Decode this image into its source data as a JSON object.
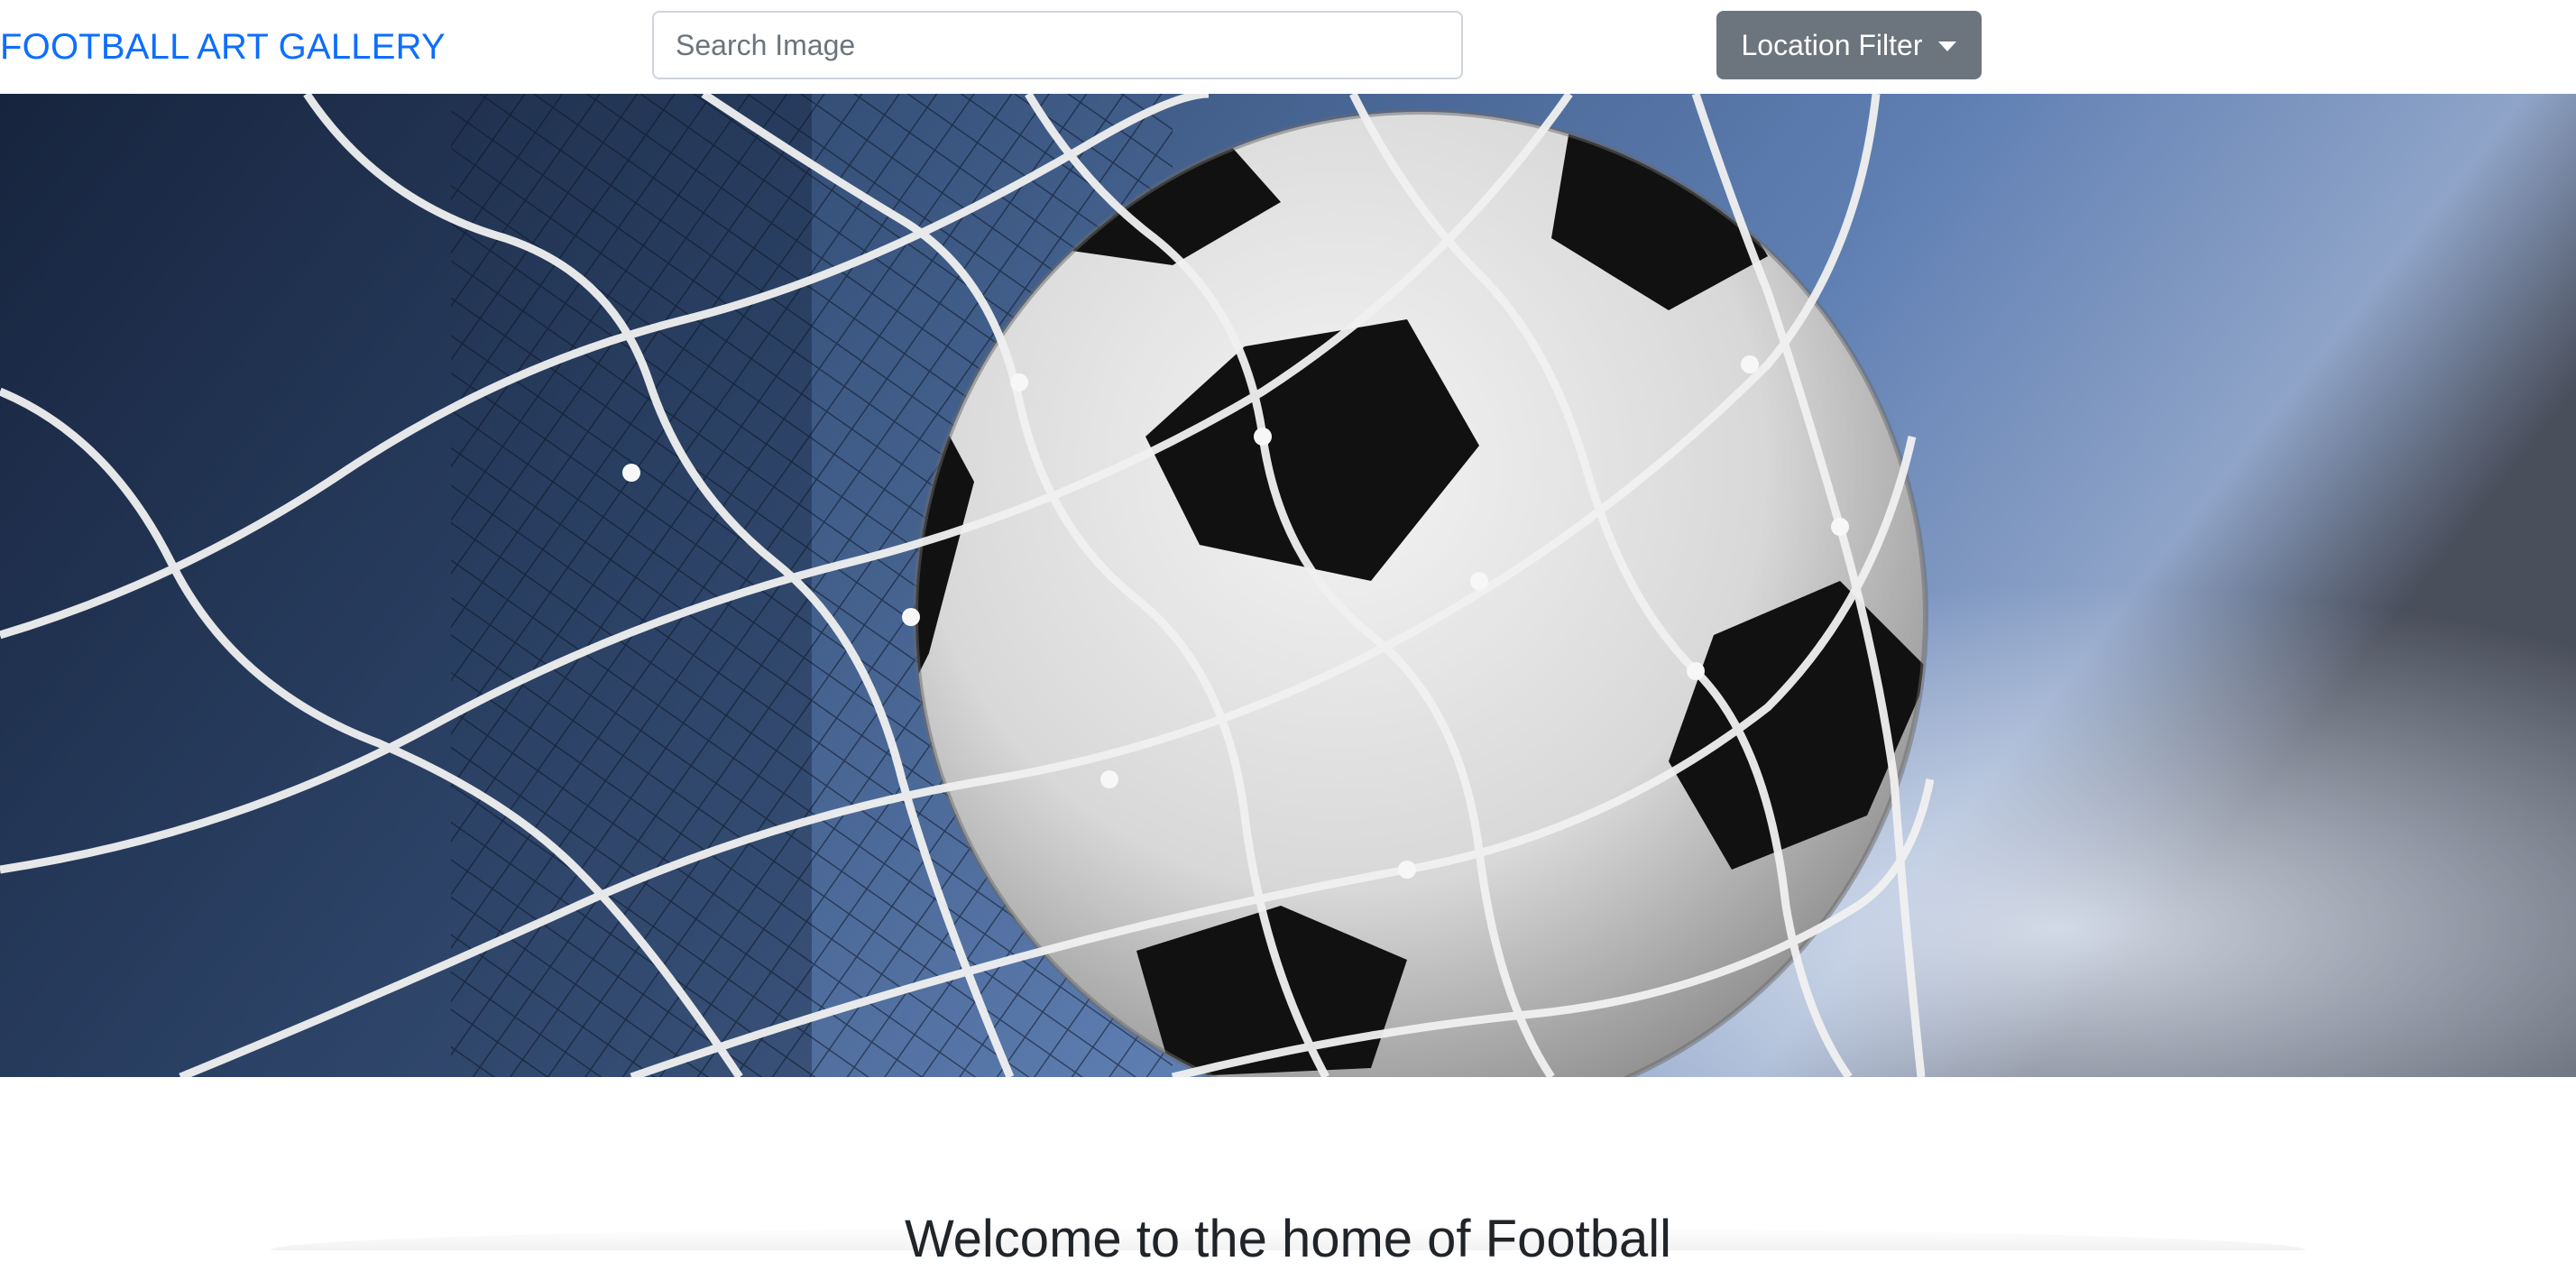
{
  "navbar": {
    "brand": "FOOTBALL ART GALLERY",
    "search_placeholder": "Search Image",
    "search_value": "",
    "filter_label": "Location Filter"
  },
  "hero": {
    "subject": "soccer ball in goal net",
    "icon": "caret-down-icon"
  },
  "main": {
    "welcome_heading": "Welcome to the home of Football"
  },
  "colors": {
    "brand": "#0d6efd",
    "button": "#6c757d",
    "text": "#212529"
  }
}
